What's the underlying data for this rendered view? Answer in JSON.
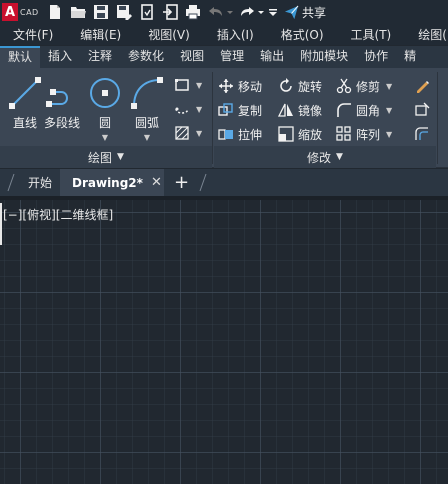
{
  "app": {
    "logo_letter": "A",
    "logo_text": "CAD"
  },
  "quick_access": {
    "share_label": "共享"
  },
  "menubar": {
    "items": [
      "文件(F)",
      "编辑(E)",
      "视图(V)",
      "插入(I)",
      "格式(O)",
      "工具(T)",
      "绘图(D)"
    ]
  },
  "ribbon_tabs": {
    "items": [
      "默认",
      "插入",
      "注释",
      "参数化",
      "视图",
      "管理",
      "输出",
      "附加模块",
      "协作",
      "精"
    ],
    "active_index": 0
  },
  "draw_panel": {
    "title": "绘图",
    "tools": {
      "line": "直线",
      "polyline": "多段线",
      "circle": "圆",
      "arc": "圆弧"
    }
  },
  "modify_panel": {
    "title": "修改",
    "tools": {
      "move": "移动",
      "rotate": "旋转",
      "trim": "修剪",
      "copy": "复制",
      "mirror": "镜像",
      "fillet": "圆角",
      "stretch": "拉伸",
      "scale": "缩放",
      "array": "阵列"
    }
  },
  "file_tabs": {
    "start": "开始",
    "drawing": "Drawing2*"
  },
  "viewport": {
    "controls": "[−][俯视][二维线框]"
  },
  "colors": {
    "accent": "#3b97d3",
    "logo_red": "#c8102e",
    "canvas": "#212830"
  }
}
